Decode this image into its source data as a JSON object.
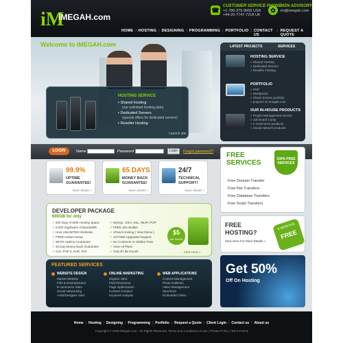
{
  "brand": {
    "logo_mark": "iM",
    "name": "iMEGAH.com"
  },
  "header": {
    "phone": {
      "title": "CUSTOMER SERVICE PHONE",
      "lines": [
        "+1-786-375-9659 USA",
        "+44-20-7747-7218 UK"
      ],
      "icon": "phone-icon"
    },
    "msn": {
      "title": "MSN ADVISORY",
      "lines": [
        "im@imegah.com"
      ],
      "icon": "msn-icon"
    }
  },
  "nav": [
    "HOME",
    "HOSTING",
    "DESIGNING",
    "PROGRAMMING",
    "PORTFOLIO",
    "CONTACT US",
    "REQUEST A QUOTE"
  ],
  "hero": {
    "welcome": "Welcome to iMEGAH.com",
    "hosting_box": {
      "title": "HOSTING SERVICE",
      "items": [
        {
          "label": "Shared Hosting",
          "sub": "(our unlimited hosting plan)"
        },
        {
          "label": "Dedicated Servers",
          "sub": "(special offers for dedicated servers)"
        },
        {
          "label": "Reseller Hosting",
          "sub": ""
        }
      ],
      "launch": "Launch site"
    }
  },
  "right_panel": {
    "tabs": [
      "LATEST PROJECTS",
      "SERVICES"
    ],
    "sections": [
      {
        "title": "HOSTING SERVICE",
        "lines": [
          "» Shared Hosting",
          "» Dedicated Servers",
          "» Reseller Hosting"
        ]
      },
      {
        "title": "PORTFOLIO",
        "lines": [
          "» PHP",
          "» Wordpress",
          "» Check dozens portfolio",
          "» projects on imegah.com"
        ]
      },
      {
        "title": "OUR IN-HOUSE PRODUCTS",
        "lines": [
          "» Project Management service",
          "» Job Board Comp",
          "» e-Commerce products",
          "» Social network products"
        ]
      }
    ]
  },
  "login": {
    "badge": "LOGIN",
    "name_label": "Name",
    "password_label": "Password",
    "button": "Login",
    "forgot": "Forgot password?"
  },
  "features": [
    {
      "big": "99.9%",
      "line1": "UPTIME",
      "line2": "GUARANTEE!",
      "more": "More details »",
      "color": "#e07a12",
      "icon": "server-monitor-icon"
    },
    {
      "big": "65 DAYS",
      "line1": "MONEY BACK",
      "line2": "GUARANTEE!",
      "more": "More details »",
      "color": "#e07a12",
      "icon": "money-back-icon"
    },
    {
      "big": "24/7",
      "line1": "TECHNICAL",
      "line2": "SUPPORT!",
      "more": "More details »",
      "color": "#333333",
      "icon": "support-icon"
    }
  ],
  "free_services": {
    "title1": "FREE",
    "title2": "SERVICES",
    "badge": "100% FREE SERVICES",
    "items": [
      "Free Domain Transfer",
      "Free File Transfers",
      "Free Database Transfers",
      "Free Script Transfers"
    ]
  },
  "developer": {
    "title": "DEVELOPER PACKAGE",
    "price_line": "600GB for only",
    "col1": [
      "600 Gigs of Web Hosting Space",
      "6,000 Gigabytes of Bandwidth",
      "Host UNLIMITED Websites",
      "FREE Instant Setup",
      "99.9% Uptime Guarantee",
      "45 Day Money Back Guarantee",
      "CGI, PHP 5, RoR, Perl"
    ],
    "col2": [
      "MySQL, SSH, SSL, IMAP, POP",
      "FREE Site Builder",
      "cPanel Hosting ( View Demo )",
      "24/7/365 Upgraded Support",
      "No Contracts or Hidden Fees",
      "View All Plans",
      "Only $7.95 /month"
    ],
    "price": "$5",
    "price_per": "per month",
    "more": "Click Here »"
  },
  "free_hosting": {
    "title1": "FREE",
    "title2": "HOSTING?",
    "link": "Click Here For More Details »",
    "badge_top": "6 MONTHS",
    "badge_bottom": "FREE"
  },
  "featured": {
    "title": "FEATURED SERVICES",
    "columns": [
      {
        "head": "WEBSITE DESIGN",
        "items": [
          "Market Website",
          "Film & Entertainment",
          "E-commerce Sites",
          "Social Networking",
          "Artist/Designer Sites"
        ]
      },
      {
        "head": "ONLINE MARKETING",
        "items": [
          "Organic SEO",
          "Paid Placement",
          "Page Optimization",
          "Content Creation",
          "Keyword Analysis"
        ]
      },
      {
        "head": "WEB APPLICATIONS",
        "items": [
          "Content Management",
          "Photo Galleries",
          "Video Management",
          "Storefront",
          "Embedded Video"
        ]
      }
    ]
  },
  "promo": {
    "title": "Get 50%",
    "sub": "Off On Hosting"
  },
  "footer": {
    "nav": [
      "Home",
      "Hosting",
      "Designing",
      "Programming",
      "Portfolio",
      "Request a Quote",
      "Client Login",
      "Contact us",
      "About us"
    ],
    "copyright": "Copyright © 2009 iMegah.com - All Rights Reserved.  Terms and Conditions of use | Private Policy | Tell a Friend"
  }
}
